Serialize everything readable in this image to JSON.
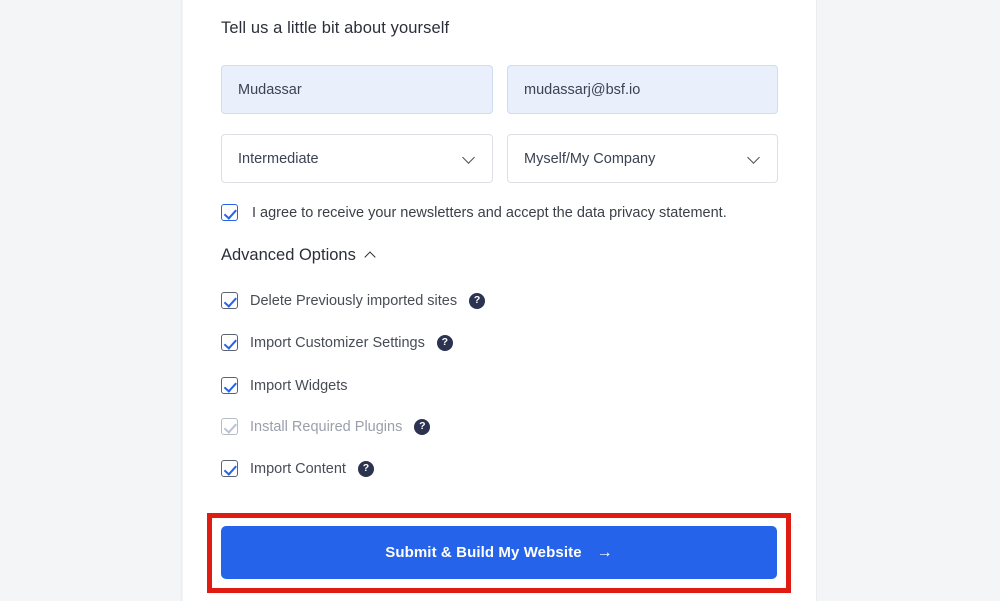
{
  "form": {
    "heading": "Tell us a little bit about yourself",
    "fields": [
      {
        "name": "first-name",
        "value": "Mudassar",
        "type": "text"
      },
      {
        "name": "email",
        "value": "mudassarj@bsf.io",
        "type": "text"
      },
      {
        "name": "experience-level",
        "value": "Intermediate",
        "type": "select"
      },
      {
        "name": "building-for",
        "value": "Myself/My Company",
        "type": "select"
      }
    ],
    "newsletter": {
      "label": "I agree to receive your newsletters and accept the data privacy statement.",
      "checked": true
    },
    "advanced": {
      "title": "Advanced Options",
      "toggle_icon": "chevron-up-icon",
      "expanded": true,
      "options": [
        {
          "label": "Delete Previously imported sites",
          "checked": true,
          "disabled": false,
          "help": true,
          "help_icon": "question-mark-icon"
        },
        {
          "label": "Import Customizer Settings",
          "checked": true,
          "disabled": false,
          "help": true,
          "help_icon": "question-mark-icon"
        },
        {
          "label": "Import Widgets",
          "checked": true,
          "disabled": false,
          "help": false,
          "help_icon": ""
        },
        {
          "label": "Install Required Plugins",
          "checked": true,
          "disabled": true,
          "help": true,
          "help_icon": "question-mark-icon"
        },
        {
          "label": "Import Content",
          "checked": true,
          "disabled": false,
          "help": true,
          "help_icon": "question-mark-icon"
        }
      ]
    },
    "submit": {
      "label": "Submit & Build My Website",
      "arrow_icon": "arrow-right-icon",
      "arrow_glyph": "→"
    }
  },
  "annotation": {
    "highlight_color": "#e01b12"
  },
  "colors": {
    "accent": "#2563eb",
    "input_bg": "#e9effb",
    "page_bg": "#f4f5f7",
    "help_bg": "#2b3350"
  },
  "help_glyph": "?"
}
